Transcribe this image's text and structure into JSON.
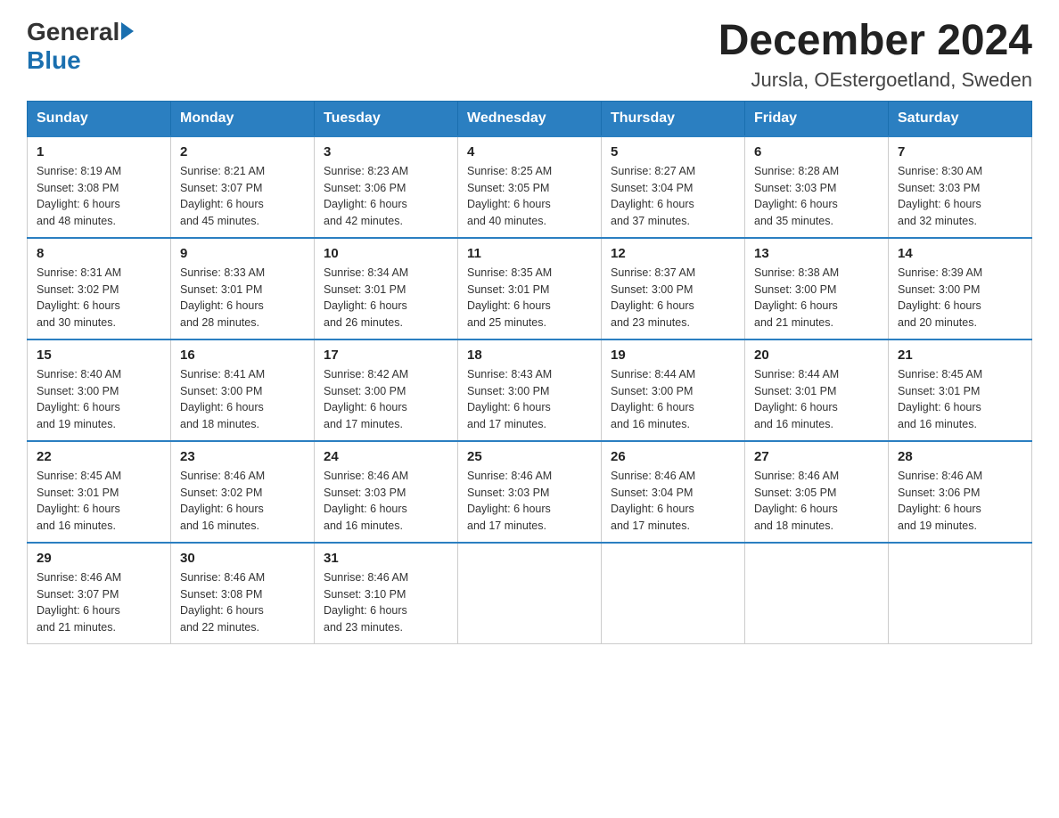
{
  "header": {
    "logo_general": "General",
    "logo_blue": "Blue",
    "month_title": "December 2024",
    "location": "Jursla, OEstergoetland, Sweden"
  },
  "days_of_week": [
    "Sunday",
    "Monday",
    "Tuesday",
    "Wednesday",
    "Thursday",
    "Friday",
    "Saturday"
  ],
  "weeks": [
    [
      {
        "day": "1",
        "sunrise": "8:19 AM",
        "sunset": "3:08 PM",
        "daylight": "6 hours and 48 minutes."
      },
      {
        "day": "2",
        "sunrise": "8:21 AM",
        "sunset": "3:07 PM",
        "daylight": "6 hours and 45 minutes."
      },
      {
        "day": "3",
        "sunrise": "8:23 AM",
        "sunset": "3:06 PM",
        "daylight": "6 hours and 42 minutes."
      },
      {
        "day": "4",
        "sunrise": "8:25 AM",
        "sunset": "3:05 PM",
        "daylight": "6 hours and 40 minutes."
      },
      {
        "day": "5",
        "sunrise": "8:27 AM",
        "sunset": "3:04 PM",
        "daylight": "6 hours and 37 minutes."
      },
      {
        "day": "6",
        "sunrise": "8:28 AM",
        "sunset": "3:03 PM",
        "daylight": "6 hours and 35 minutes."
      },
      {
        "day": "7",
        "sunrise": "8:30 AM",
        "sunset": "3:03 PM",
        "daylight": "6 hours and 32 minutes."
      }
    ],
    [
      {
        "day": "8",
        "sunrise": "8:31 AM",
        "sunset": "3:02 PM",
        "daylight": "6 hours and 30 minutes."
      },
      {
        "day": "9",
        "sunrise": "8:33 AM",
        "sunset": "3:01 PM",
        "daylight": "6 hours and 28 minutes."
      },
      {
        "day": "10",
        "sunrise": "8:34 AM",
        "sunset": "3:01 PM",
        "daylight": "6 hours and 26 minutes."
      },
      {
        "day": "11",
        "sunrise": "8:35 AM",
        "sunset": "3:01 PM",
        "daylight": "6 hours and 25 minutes."
      },
      {
        "day": "12",
        "sunrise": "8:37 AM",
        "sunset": "3:00 PM",
        "daylight": "6 hours and 23 minutes."
      },
      {
        "day": "13",
        "sunrise": "8:38 AM",
        "sunset": "3:00 PM",
        "daylight": "6 hours and 21 minutes."
      },
      {
        "day": "14",
        "sunrise": "8:39 AM",
        "sunset": "3:00 PM",
        "daylight": "6 hours and 20 minutes."
      }
    ],
    [
      {
        "day": "15",
        "sunrise": "8:40 AM",
        "sunset": "3:00 PM",
        "daylight": "6 hours and 19 minutes."
      },
      {
        "day": "16",
        "sunrise": "8:41 AM",
        "sunset": "3:00 PM",
        "daylight": "6 hours and 18 minutes."
      },
      {
        "day": "17",
        "sunrise": "8:42 AM",
        "sunset": "3:00 PM",
        "daylight": "6 hours and 17 minutes."
      },
      {
        "day": "18",
        "sunrise": "8:43 AM",
        "sunset": "3:00 PM",
        "daylight": "6 hours and 17 minutes."
      },
      {
        "day": "19",
        "sunrise": "8:44 AM",
        "sunset": "3:00 PM",
        "daylight": "6 hours and 16 minutes."
      },
      {
        "day": "20",
        "sunrise": "8:44 AM",
        "sunset": "3:01 PM",
        "daylight": "6 hours and 16 minutes."
      },
      {
        "day": "21",
        "sunrise": "8:45 AM",
        "sunset": "3:01 PM",
        "daylight": "6 hours and 16 minutes."
      }
    ],
    [
      {
        "day": "22",
        "sunrise": "8:45 AM",
        "sunset": "3:01 PM",
        "daylight": "6 hours and 16 minutes."
      },
      {
        "day": "23",
        "sunrise": "8:46 AM",
        "sunset": "3:02 PM",
        "daylight": "6 hours and 16 minutes."
      },
      {
        "day": "24",
        "sunrise": "8:46 AM",
        "sunset": "3:03 PM",
        "daylight": "6 hours and 16 minutes."
      },
      {
        "day": "25",
        "sunrise": "8:46 AM",
        "sunset": "3:03 PM",
        "daylight": "6 hours and 17 minutes."
      },
      {
        "day": "26",
        "sunrise": "8:46 AM",
        "sunset": "3:04 PM",
        "daylight": "6 hours and 17 minutes."
      },
      {
        "day": "27",
        "sunrise": "8:46 AM",
        "sunset": "3:05 PM",
        "daylight": "6 hours and 18 minutes."
      },
      {
        "day": "28",
        "sunrise": "8:46 AM",
        "sunset": "3:06 PM",
        "daylight": "6 hours and 19 minutes."
      }
    ],
    [
      {
        "day": "29",
        "sunrise": "8:46 AM",
        "sunset": "3:07 PM",
        "daylight": "6 hours and 21 minutes."
      },
      {
        "day": "30",
        "sunrise": "8:46 AM",
        "sunset": "3:08 PM",
        "daylight": "6 hours and 22 minutes."
      },
      {
        "day": "31",
        "sunrise": "8:46 AM",
        "sunset": "3:10 PM",
        "daylight": "6 hours and 23 minutes."
      },
      null,
      null,
      null,
      null
    ]
  ],
  "labels": {
    "sunrise": "Sunrise:",
    "sunset": "Sunset:",
    "daylight": "Daylight:"
  }
}
